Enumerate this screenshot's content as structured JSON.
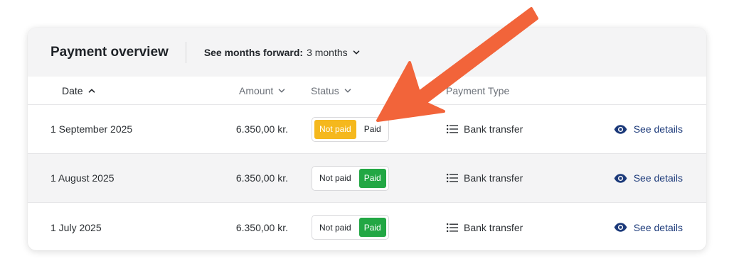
{
  "header": {
    "title": "Payment overview",
    "months_label": "See months forward:",
    "months_value": "3 months",
    "icon": "chevron-down-icon"
  },
  "columns": {
    "date": "Date",
    "amount": "Amount",
    "status": "Status",
    "payment_type": "Payment Type"
  },
  "rows": [
    {
      "date": "1 September 2025",
      "amount": "6.350,00 kr.",
      "not_paid_label": "Not paid",
      "paid_label": "Paid",
      "status": "Not paid",
      "payment_type": "Bank transfer",
      "details_label": "See details"
    },
    {
      "date": "1 August 2025",
      "amount": "6.350,00 kr.",
      "not_paid_label": "Not paid",
      "paid_label": "Paid",
      "status": "Paid",
      "payment_type": "Bank transfer",
      "details_label": "See details"
    },
    {
      "date": "1 July 2025",
      "amount": "6.350,00 kr.",
      "not_paid_label": "Not paid",
      "paid_label": "Paid",
      "status": "Paid",
      "payment_type": "Bank transfer",
      "details_label": "See details"
    }
  ],
  "colors": {
    "not_paid_active": "#f5b81d",
    "paid_active": "#22a744",
    "link": "#1c3a7a",
    "annotation_arrow": "#f2643a"
  }
}
